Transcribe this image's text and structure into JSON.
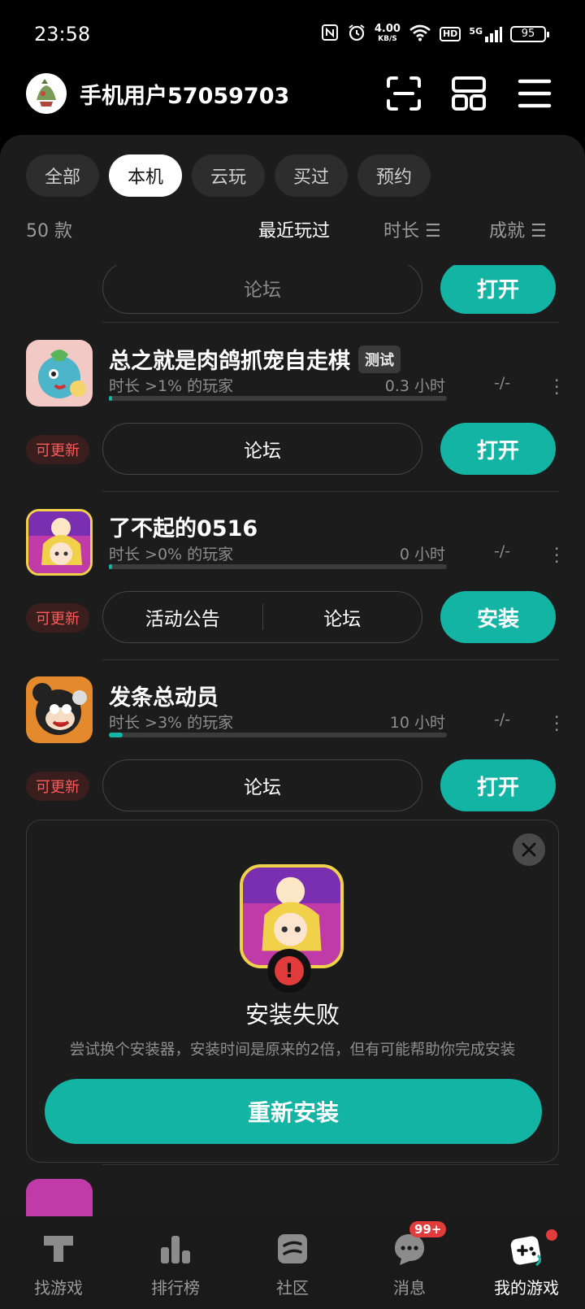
{
  "status_bar": {
    "time": "23:58",
    "net_speed": "4.00",
    "net_unit": "KB/S",
    "hd": "HD",
    "signal": "5G",
    "battery": "95"
  },
  "header": {
    "username": "手机用户57059703"
  },
  "filters": {
    "tabs": [
      "全部",
      "本机",
      "云玩",
      "买过",
      "预约"
    ],
    "active": "本机"
  },
  "sort": {
    "count": "50 款",
    "recent": "最近玩过",
    "duration": "时长 ☰",
    "achievement": "成就 ☰"
  },
  "list": {
    "top_partial": {
      "forum": "论坛",
      "action": "打开"
    },
    "games": [
      {
        "title": "总之就是肉鸽抓宠自走棋",
        "badge": "测试",
        "stat": "时长 >1% 的玩家",
        "hours": "0.3 小时",
        "achievement": "-/-",
        "progress": 0.01,
        "update": "可更新",
        "links": [
          "论坛"
        ],
        "action": "打开"
      },
      {
        "title": "了不起的0516",
        "badge": "",
        "stat": "时长 >0% 的玩家",
        "hours": "0 小时",
        "achievement": "-/-",
        "progress": 0.0,
        "update": "可更新",
        "links": [
          "活动公告",
          "论坛"
        ],
        "action": "安装"
      },
      {
        "title": "发条总动员",
        "badge": "",
        "stat": "时长 >3% 的玩家",
        "hours": "10 小时",
        "achievement": "-/-",
        "progress": 0.03,
        "update": "可更新",
        "links": [
          "论坛"
        ],
        "action": "打开"
      }
    ]
  },
  "install_failed": {
    "title": "安装失败",
    "description": "尝试换个安装器，安装时间是原来的2倍，但有可能帮助你完成安装",
    "button": "重新安装"
  },
  "bottom_nav": {
    "items": [
      "找游戏",
      "排行榜",
      "社区",
      "消息",
      "我的游戏"
    ],
    "active": "我的游戏",
    "message_badge": "99+"
  },
  "colors": {
    "accent": "#14b4a4",
    "update_red": "#ff5a5a",
    "panel": "#1c1c1c"
  }
}
